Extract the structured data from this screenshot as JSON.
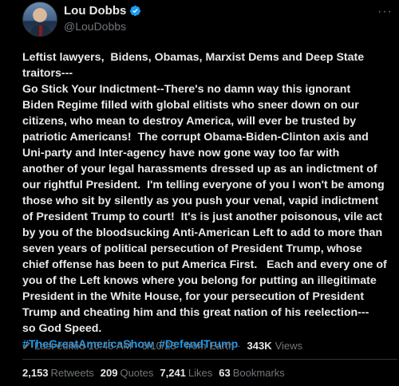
{
  "author": {
    "display_name": "Lou Dobbs",
    "handle": "@LouDobbs",
    "verified_icon": "verified-badge-icon",
    "accent_color": "#1d9bf0"
  },
  "tweet": {
    "lines": [
      "Leftist lawyers,  Bidens, Obamas, Marxist Dems and Deep State",
      "traitors---",
      "Go Stick Your Indictment--There's no damn way this ignorant",
      "Biden Regime filled with global elitists who sneer down on our",
      "citizens, who mean to destroy America, will ever be trusted by",
      "patriotic Americans!  The corrupt Obama-Biden-Clinton axis and",
      "Uni-party and Inter-agency have now gone way too far with",
      "another of your legal harassments dressed up as an indictment of",
      "our rightful President.  I'm telling everyone of you I won't be among",
      "those who sit by silently as you push your venal, vapid indictment",
      "of President Trump to court!  It's is just another poisonous, vile act",
      "by you of the bloodsucking Anti-American Left to add to more than",
      "seven years of political persecution of President Trump, whose",
      "chief offense has been to put America First.   Each and every one of",
      "you of the Left knows where you belong for putting an illegitimate",
      "President in the White House, for your persecution of President",
      "Trump and cheating him and this great nation of his reelection---",
      "so God Speed."
    ],
    "hashtags": [
      "#TheGreatAmericaShow",
      "#DefendTrump"
    ]
  },
  "meta": {
    "edited_label": "Last edited 10:45 AM",
    "date": "6/10/23",
    "source": "from Earth",
    "views_count": "343K",
    "views_label": "Views"
  },
  "stats": [
    {
      "num": "2,153",
      "label": "Retweets"
    },
    {
      "num": "209",
      "label": "Quotes"
    },
    {
      "num": "7,241",
      "label": "Likes"
    },
    {
      "num": "63",
      "label": "Bookmarks"
    }
  ]
}
